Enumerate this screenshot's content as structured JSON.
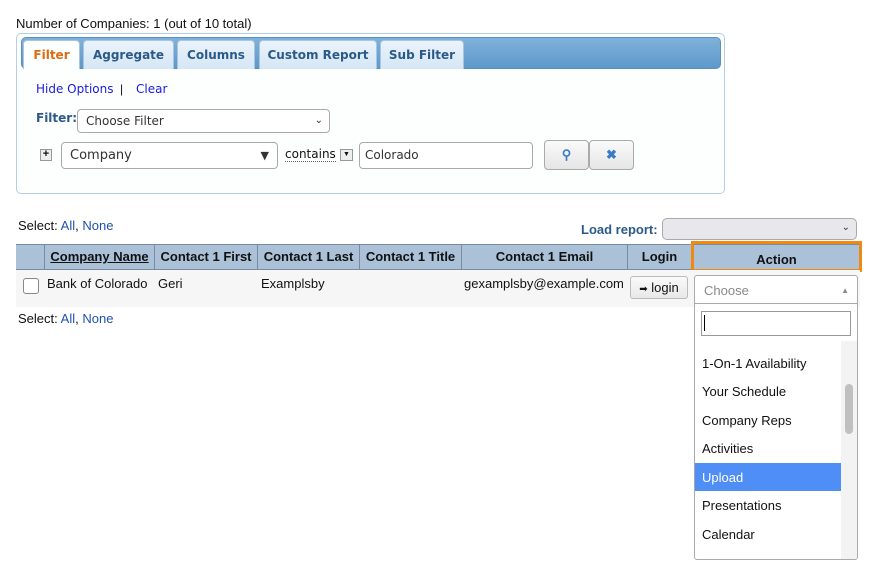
{
  "summary": "Number of Companies: 1 (out of 10 total)",
  "tabs": [
    "Filter",
    "Aggregate",
    "Columns",
    "Custom Report",
    "Sub Filter"
  ],
  "links": {
    "hide": "Hide Options",
    "sep": "|",
    "clear": "Clear"
  },
  "filter": {
    "label": "Filter:",
    "choose": "Choose Filter",
    "field": "Company",
    "operator": "contains",
    "value": "Colorado"
  },
  "select": {
    "label": "Select:",
    "all": "All",
    "comma": ",",
    "none": "None"
  },
  "load_report": {
    "label": "Load report:",
    "value": ""
  },
  "columns": [
    "Company Name",
    "Contact 1 First",
    "Contact 1 Last",
    "Contact 1 Title",
    "Contact 1 Email",
    "Login",
    "Action"
  ],
  "rows": [
    {
      "company": "Bank of Colorado",
      "first": "Geri",
      "last": "Examplsby",
      "title": "",
      "email": "gexamplsby@example.com",
      "login": "login"
    }
  ],
  "action_dropdown": {
    "placeholder": "Choose",
    "search": "",
    "items": [
      "1-On-1 Availability",
      "Your Schedule",
      "Company Reps",
      "Activities",
      "Upload",
      "Presentations",
      "Calendar"
    ],
    "highlighted": "Upload"
  },
  "colors": {
    "accent": "#f0890f",
    "highlight": "#4f8ef7",
    "header": "#aac1d8"
  }
}
